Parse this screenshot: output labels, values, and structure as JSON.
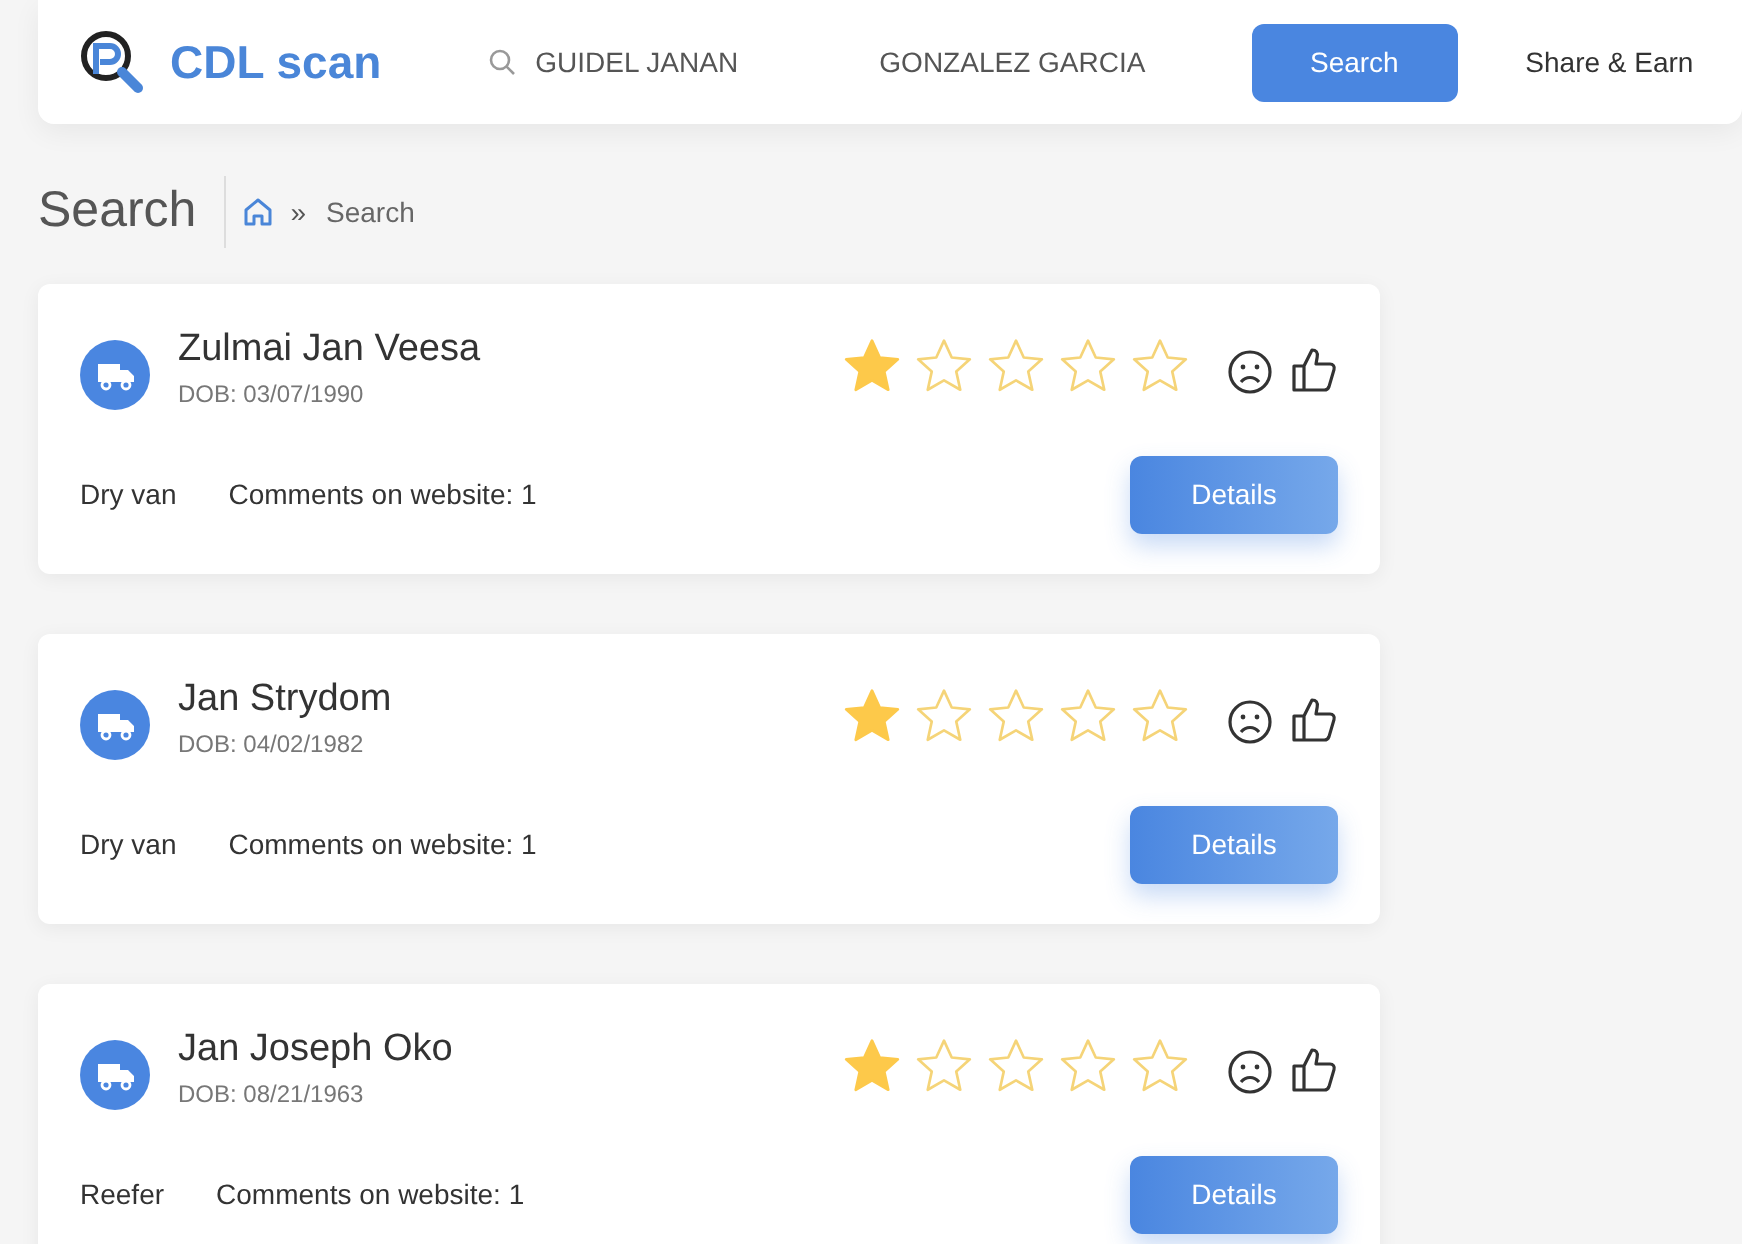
{
  "header": {
    "logo": "CDL scan",
    "first_name": "GUIDEL JANAN",
    "last_name": "GONZALEZ GARCIA",
    "search_button": "Search",
    "share_link": "Share & Earn"
  },
  "page_title": "Search",
  "breadcrumb": {
    "separator": "»",
    "current": "Search"
  },
  "drivers": [
    {
      "name": "Zulmai Jan Veesa",
      "dob": "DOB: 03/07/1990",
      "stars": 1,
      "trailer": "Dry van",
      "comments": "Comments on website: 1",
      "button": "Details"
    },
    {
      "name": "Jan Strydom",
      "dob": "DOB: 04/02/1982",
      "stars": 1,
      "trailer": "Dry van",
      "comments": "Comments on website: 1",
      "button": "Details"
    },
    {
      "name": "Jan Joseph Oko",
      "dob": "DOB: 08/21/1963",
      "stars": 1,
      "trailer": "Reefer",
      "comments": "Comments on website: 1",
      "button": "Details"
    }
  ]
}
